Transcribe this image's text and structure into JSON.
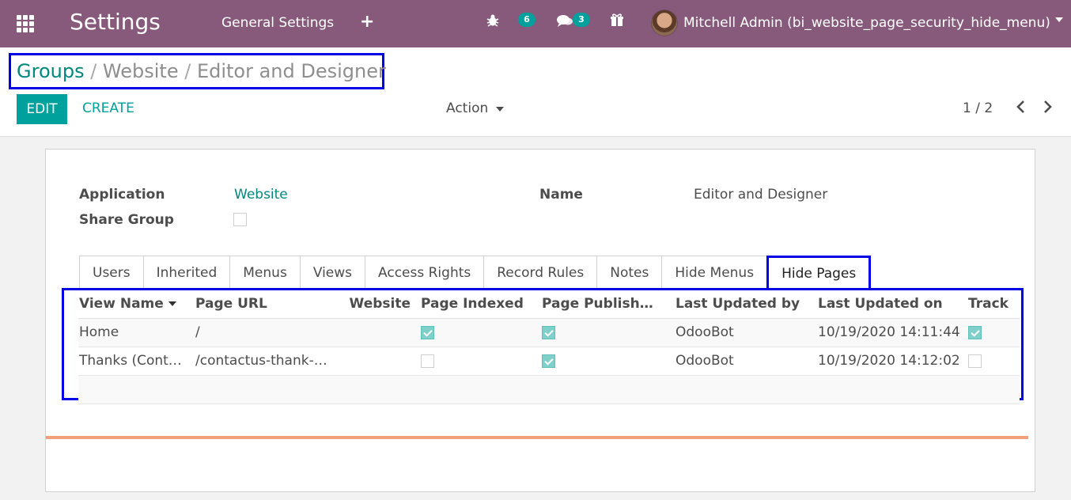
{
  "navbar": {
    "app_title": "Settings",
    "menu_general": "General Settings",
    "menu_plus": "+",
    "bug_count": "6",
    "chat_count": "3",
    "user_name": "Mitchell Admin (bi_website_page_security_hide_menu)"
  },
  "breadcrumb": {
    "groups": "Groups",
    "sep": " / ",
    "website": "Website",
    "current": "Editor and Designer"
  },
  "buttons": {
    "edit": "EDIT",
    "create": "CREATE",
    "action": "Action"
  },
  "pager": {
    "value": "1 / 2"
  },
  "form": {
    "application_label": "Application",
    "application_value": "Website",
    "share_group_label": "Share Group",
    "share_group_checked": false,
    "name_label": "Name",
    "name_value": "Editor and Designer"
  },
  "tabs": [
    "Users",
    "Inherited",
    "Menus",
    "Views",
    "Access Rights",
    "Record Rules",
    "Notes",
    "Hide Menus",
    "Hide Pages"
  ],
  "active_tab": "Hide Pages",
  "table": {
    "columns": [
      "View Name",
      "Page URL",
      "Website",
      "Page Indexed",
      "Page Publish…",
      "Last Updated by",
      "Last Updated on",
      "Track"
    ],
    "rows": [
      {
        "view_name": "Home",
        "page_url": "/",
        "website": "",
        "indexed": true,
        "published": true,
        "updated_by": "OdooBot",
        "updated_on": "10/19/2020 14:11:44",
        "track": true
      },
      {
        "view_name": "Thanks (Cont…",
        "page_url": "/contactus-thank-…",
        "website": "",
        "indexed": false,
        "published": true,
        "updated_by": "OdooBot",
        "updated_on": "10/19/2020 14:12:02",
        "track": false
      }
    ]
  },
  "colors": {
    "navbar": "#875a7b",
    "accent": "#00a09d",
    "highlight_box": "#0000e6",
    "chatter_line": "#f0a07a"
  },
  "icons": [
    "apps-grid-icon",
    "plus-icon",
    "bug-icon",
    "chat-icon",
    "gift-icon",
    "caret-down-icon",
    "chevron-left-icon",
    "chevron-right-icon",
    "checkbox-icon"
  ]
}
